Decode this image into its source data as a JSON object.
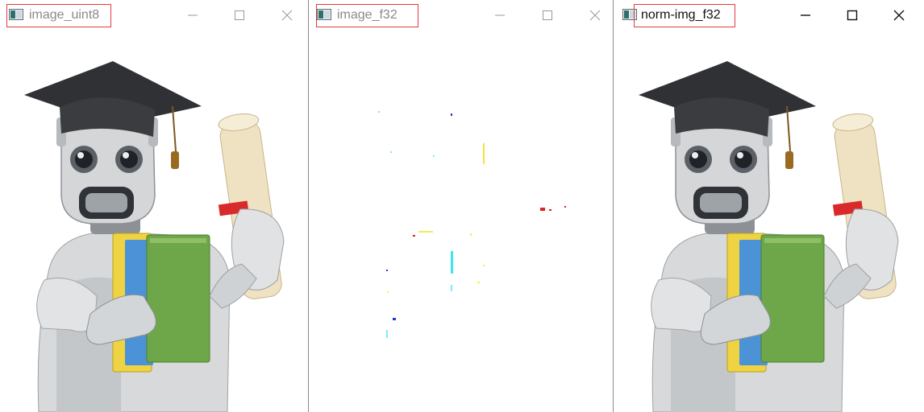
{
  "windows": [
    {
      "title": "image_uint8",
      "active": false
    },
    {
      "title": "image_f32",
      "active": false
    },
    {
      "title": "norm-img_f32",
      "active": true
    }
  ],
  "icons": {
    "app": "opencv-window-icon",
    "minimize": "minimize-icon",
    "maximize": "maximize-icon",
    "close": "close-icon"
  },
  "colors": {
    "title_highlight": "#e23b3b",
    "inactive_title": "#8a8a8a",
    "active_title": "#111111"
  }
}
